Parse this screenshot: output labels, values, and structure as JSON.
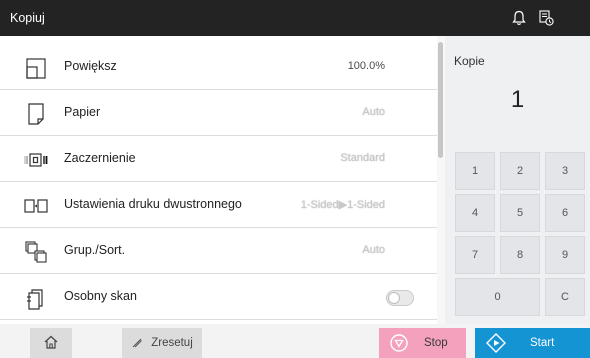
{
  "header": {
    "title": "Kopiuj",
    "bell_icon": "bell-icon",
    "job_icon": "job-status-icon"
  },
  "settings": [
    {
      "label": "Powiększ",
      "value": "100.0%",
      "icon": "zoom-icon",
      "enabled": true
    },
    {
      "label": "Papier",
      "value": "Auto",
      "icon": "paper-icon",
      "enabled": false
    },
    {
      "label": "Zaczernienie",
      "value": "Standard",
      "icon": "density-icon",
      "enabled": false
    },
    {
      "label": "Ustawienia druku dwustronnego",
      "value": "1-Sided▶1-Sided",
      "icon": "duplex-icon",
      "enabled": false
    },
    {
      "label": "Grup./Sort.",
      "value": "Auto",
      "icon": "sort-icon",
      "enabled": false
    },
    {
      "label": "Osobny skan",
      "icon": "separate-scan-icon",
      "toggle_on": false
    }
  ],
  "copies": {
    "label": "Kopie",
    "count": "1"
  },
  "keypad": [
    "1",
    "2",
    "3",
    "4",
    "5",
    "6",
    "7",
    "8",
    "9",
    "0",
    "C"
  ],
  "footer": {
    "home_icon": "home-icon",
    "reset_label": "Zresetuj",
    "stop_label": "Stop",
    "start_label": "Start"
  },
  "colors": {
    "header_bg": "#232323",
    "stop": "#f4a1bd",
    "start": "#1594d4",
    "panel_bg": "#eef0f2"
  }
}
